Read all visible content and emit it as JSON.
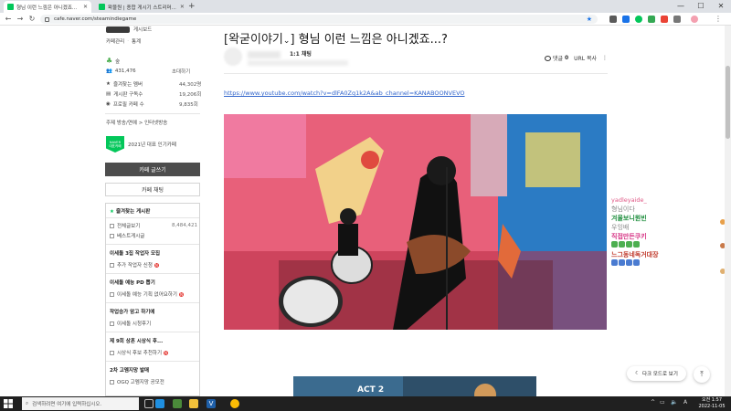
{
  "browser": {
    "tabs": [
      {
        "title": "형님 이런 느낌은 아니겠죠...",
        "active": true
      },
      {
        "title": "왁물원 | 종합 게시기 스트리머...",
        "active": false
      }
    ],
    "new_tab": "+",
    "url": "cafe.naver.com/steamindiegame",
    "window_controls": {
      "minimize": "—",
      "maximize": "☐",
      "close": "✕"
    }
  },
  "sidebar": {
    "cafe_name": "게시보드",
    "links": [
      "카페관리",
      "통계"
    ],
    "level_label": "숲",
    "member_count": "431,476",
    "invite_label": "초대하기",
    "stats": [
      {
        "label": "즐겨찾는 멤버",
        "value": "44,302명"
      },
      {
        "label": "게시판 구독수",
        "value": "19,206회"
      },
      {
        "label": "프로필 카페 수",
        "value": "9,835회"
      }
    ],
    "topic": "주제 방송/연예 > 인터넷방송",
    "award_badge_top": "NAVER",
    "award_badge_bottom": "대표카페",
    "award_text": "2021년 대표 인기카페",
    "write_button": "카페 글쓰기",
    "chat_button": "카페 채팅",
    "fav_board_title": "즐겨찾는 게시판",
    "fav_items": [
      {
        "label": "전체글보기",
        "count": "8,484,421"
      },
      {
        "label": "베스트게시글",
        "count": ""
      }
    ],
    "sections": [
      {
        "title": "이세돌 3집 작업자 모집",
        "items": [
          {
            "label": "추가 작업자 신청",
            "new": true
          }
        ]
      },
      {
        "title": "이세돌 예능 PD 뽑기",
        "items": [
          {
            "label": "이세돌 예능 기획 없어요하기",
            "new": true
          }
        ]
      },
      {
        "title": "작업승가 암고 하기에",
        "items": [
          {
            "label": "이세돌 시청후기",
            "new": false
          }
        ]
      },
      {
        "title": "제 9회 상혼 시상식 후...",
        "items": [
          {
            "label": "시상식 후보 추천하기",
            "new": true
          }
        ]
      },
      {
        "title": "2차 고멤지망 발매",
        "items": [
          {
            "label": "OGQ 고멤지망 공모전",
            "new": false
          }
        ]
      }
    ],
    "new_dot": "N"
  },
  "post": {
    "category": "왁굳이야기",
    "title": "형님 이런 느낌은 아니겠죠...?",
    "chat_label": "1:1 채팅",
    "comments_label": "댓글",
    "comments_count": "0",
    "url_copy": "URL 복사",
    "more": "⋮",
    "link": "https://www.youtube.com/watch?v=dlFA0Zq1k2A&ab_channel=KANABOONVEVO",
    "banner_text": "ACT 2"
  },
  "chat_overlay": [
    {
      "name": "yadleyaide_",
      "msg": "형님이다",
      "color": "#e05a87"
    },
    {
      "name": "겨울보니원빈",
      "msg": "우잉배",
      "color": "#1e8e3e"
    },
    {
      "name": "직접만든쿠키",
      "msg": "",
      "color": "#d63384"
    },
    {
      "name": "느그동네독거대장",
      "msg": "",
      "color": "#c0392b"
    }
  ],
  "darkmode_label": "다크 모드로 보기",
  "top_button": "⤒",
  "taskbar": {
    "search_placeholder": "검색하려면 여기에 입력하십시오.",
    "time": "오전 1:57",
    "date": "2022-11-05",
    "lang": "A"
  },
  "colors": {
    "naver_green": "#03c75a",
    "link_blue": "#3366cc",
    "dark_button": "#4d4d4d",
    "taskbar": "#202020"
  }
}
